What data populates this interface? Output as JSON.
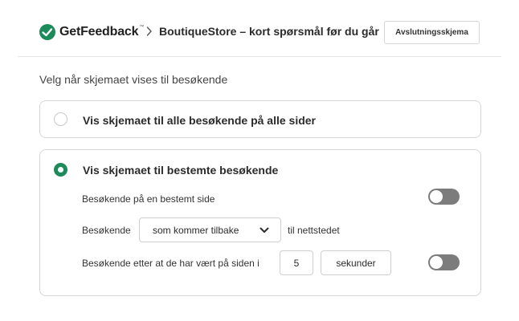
{
  "header": {
    "logo_text": "GetFeedback",
    "logo_tm": "™",
    "survey_title": "BoutiqueStore – kort spørsmål før du går",
    "survey_type_button": "Avslutningsskjema",
    "brand_color": "#1c8b5a"
  },
  "section": {
    "label": "Velg når skjemaet vises til besøkende"
  },
  "options": {
    "all": {
      "label": "Vis skjemaet til alle besøkende på alle sider",
      "selected": false
    },
    "specific": {
      "label": "Vis skjemaet til bestemte besøkende",
      "selected": true,
      "rules": {
        "specific_page": {
          "label": "Besøkende på en bestemt side",
          "enabled": false
        },
        "visitor_type": {
          "prefix": "Besøkende",
          "selected": "som kommer tilbake",
          "suffix": "til nettstedet"
        },
        "time_on_page": {
          "label": "Besøkende etter at de har vært på siden i",
          "value": "5",
          "unit": "sekunder",
          "enabled": false
        }
      }
    }
  },
  "icons": {
    "logo": "getfeedback-logo-icon",
    "breadcrumb": "chevron-right-icon",
    "select": "chevron-down-icon"
  }
}
